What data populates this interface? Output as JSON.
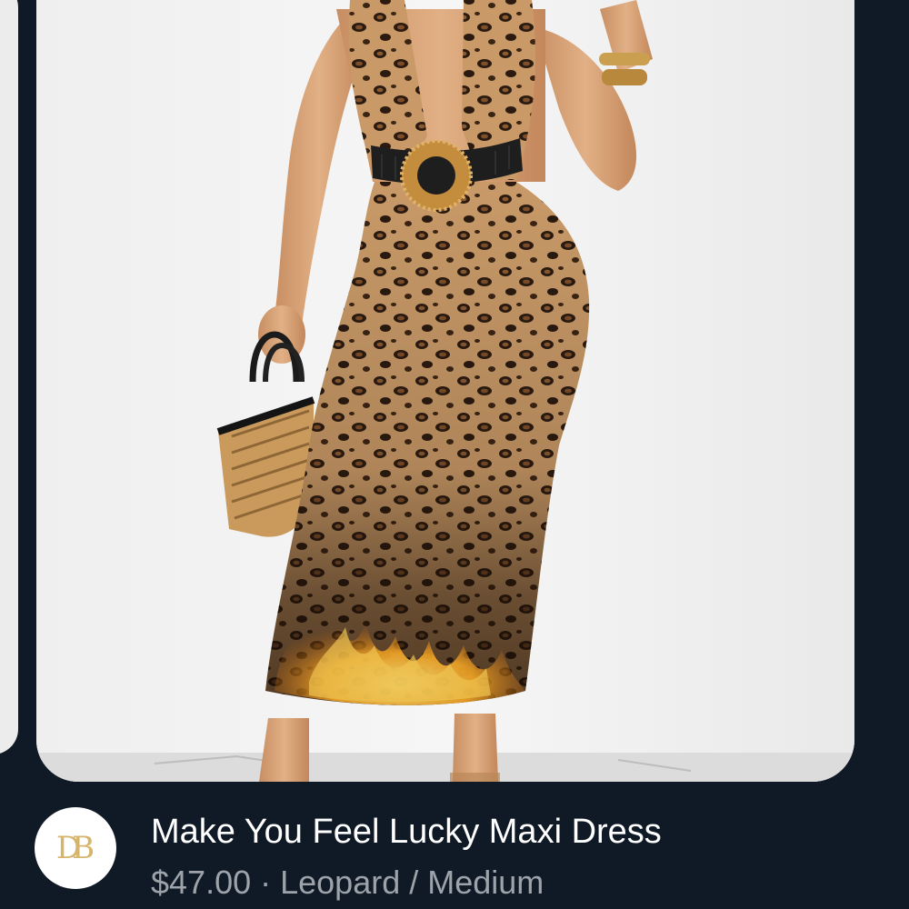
{
  "product": {
    "title": "Make You Feel Lucky Maxi Dress",
    "price": "$47.00",
    "separator": " · ",
    "variant": "Leopard / Medium",
    "image_description": "model wearing leopard and flame print halter maxi dress with black belt and round gold buckle, holding a bamboo handbag"
  },
  "brand": {
    "logo_text": "DB",
    "logo_color": "#d6b56a"
  },
  "colors": {
    "background": "#101a26",
    "card": "#f2f2f2",
    "title": "#ffffff",
    "meta": "#9ea3aa"
  }
}
